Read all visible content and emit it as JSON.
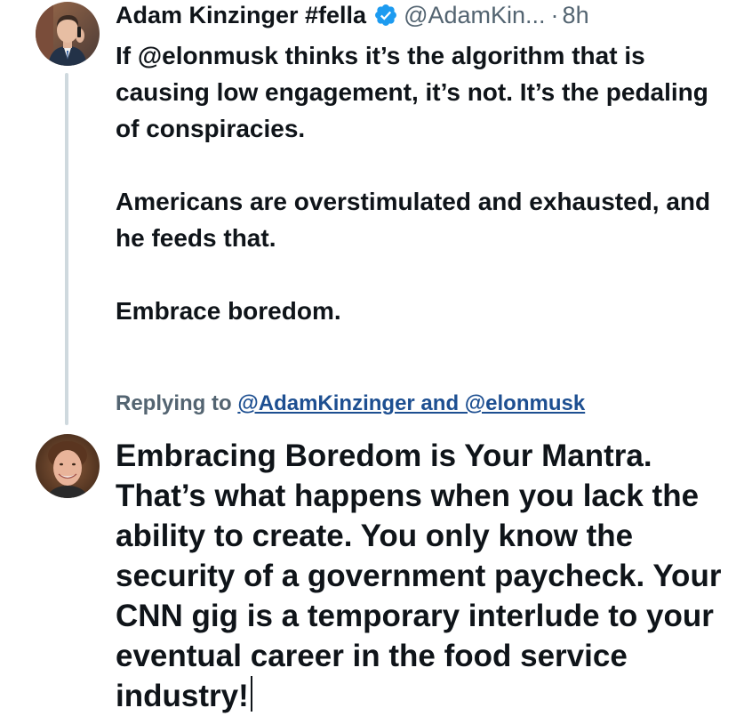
{
  "original_tweet": {
    "author": {
      "display_name": "Adam Kinzinger #fella",
      "handle": "@AdamKin...",
      "verified": true,
      "avatar_icon": "profile-photo-man-in-suit"
    },
    "separator": "·",
    "timestamp": "8h",
    "text_paragraphs": [
      "If @elonmusk thinks it’s the algorithm that is causing low engagement, it’s not.  It’s the pedaling of conspiracies.",
      "Americans are overstimulated and exhausted, and he feeds that.",
      "Embrace boredom."
    ]
  },
  "reply": {
    "replying_to_label": "Replying to",
    "replying_to_mentions": "@AdamKinzinger and @elonmusk",
    "author": {
      "avatar_icon": "profile-photo-smiling-man"
    },
    "text": "Embracing Boredom is Your Mantra. That’s what happens when you lack the ability to create. You only know the security of a government paycheck. Your CNN gig is a temporary interlude to your eventual career in the food service industry!"
  },
  "colors": {
    "text_primary": "#0f1419",
    "text_secondary": "#536471",
    "link": "#1d4f91",
    "verified_badge": "#1d9bf0",
    "thread_line": "#cfd9de"
  }
}
